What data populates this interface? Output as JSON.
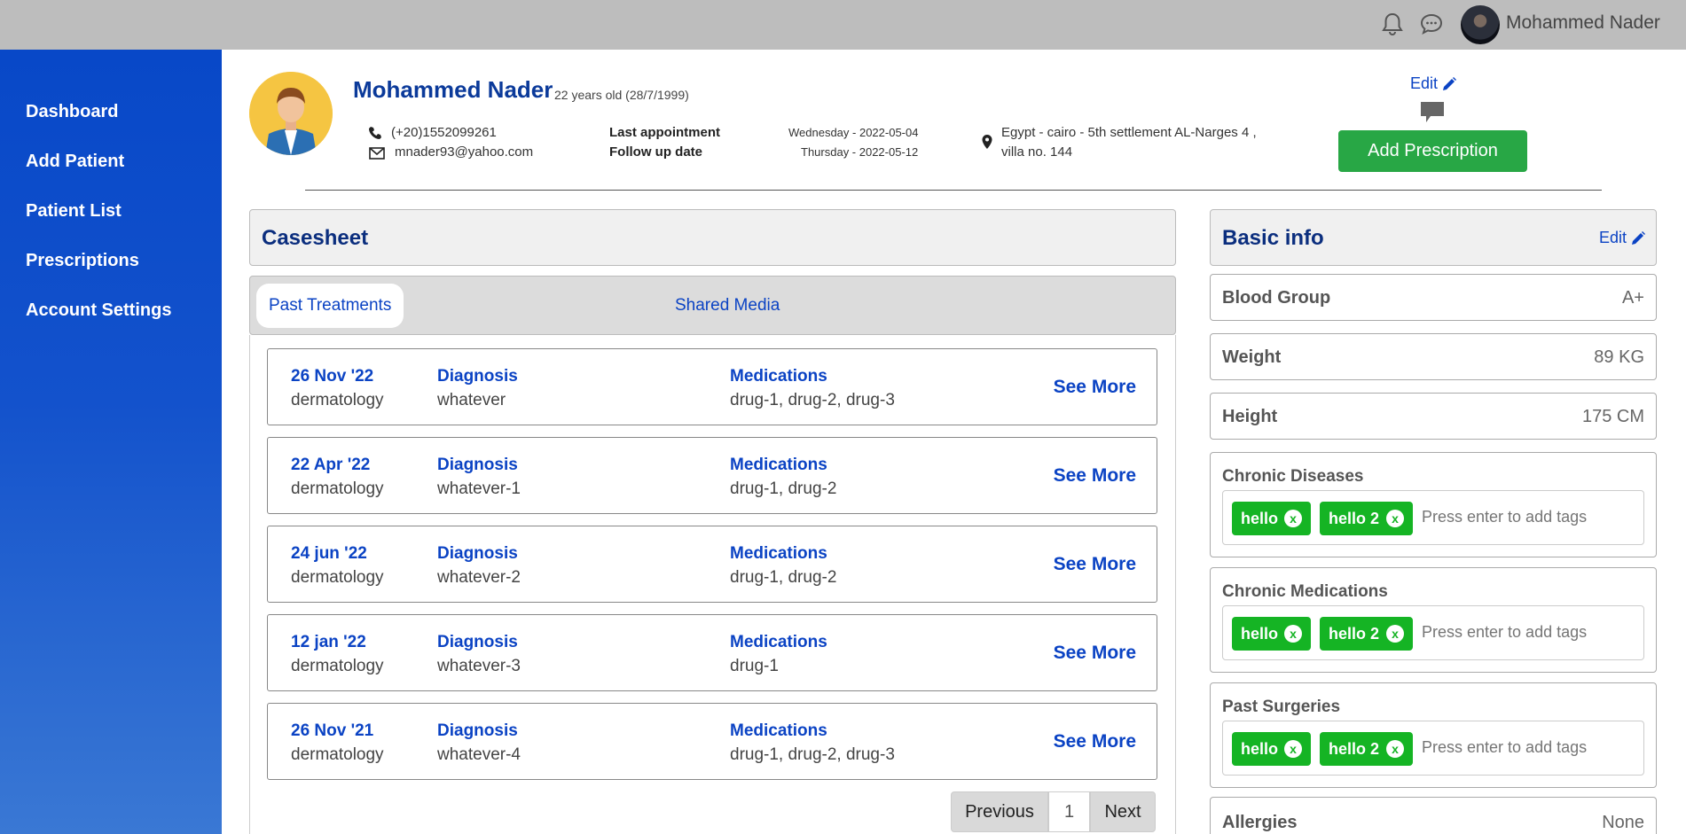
{
  "topbar": {
    "user_name": "Mohammed Nader",
    "icons": [
      "bell-icon",
      "chat-icon"
    ]
  },
  "sidebar": {
    "items": [
      {
        "label": "Dashboard"
      },
      {
        "label": "Add Patient"
      },
      {
        "label": "Patient List"
      },
      {
        "label": "Prescriptions"
      },
      {
        "label": "Account Settings"
      }
    ]
  },
  "patient": {
    "name": "Mohammed Nader",
    "age": "22 years old (28/7/1999)",
    "phone": "(+20)1552099261",
    "email": "mnader93@yahoo.com",
    "last_appointment_label": "Last appointment",
    "last_appointment": "Wednesday - 2022-05-04",
    "follow_up_label": "Follow up date",
    "follow_up": "Thursday - 2022-05-12",
    "address_line1": "Egypt - cairo - 5th settlement AL-Narges 4 ,",
    "address_line2": "villa no. 144"
  },
  "header_actions": {
    "edit_label": "Edit",
    "add_prescription_label": "Add Prescription"
  },
  "casesheet": {
    "title": "Casesheet",
    "tabs": [
      {
        "label": "Past Treatments"
      },
      {
        "label": "Shared Media"
      }
    ],
    "diagnosis_label": "Diagnosis",
    "medications_label": "Medications",
    "see_more_label": "See More",
    "treatments": [
      {
        "date": "26 Nov '22",
        "specialty": "dermatology",
        "diagnosis": "whatever",
        "medications": "drug-1, drug-2, drug-3"
      },
      {
        "date": "22 Apr '22",
        "specialty": "dermatology",
        "diagnosis": "whatever-1",
        "medications": "drug-1, drug-2"
      },
      {
        "date": "24 jun '22",
        "specialty": "dermatology",
        "diagnosis": "whatever-2",
        "medications": "drug-1, drug-2"
      },
      {
        "date": "12 jan '22",
        "specialty": "dermatology",
        "diagnosis": "whatever-3",
        "medications": "drug-1"
      },
      {
        "date": "26 Nov '21",
        "specialty": "dermatology",
        "diagnosis": "whatever-4",
        "medications": "drug-1, drug-2, drug-3"
      }
    ],
    "pagination": {
      "previous": "Previous",
      "page": "1",
      "next": "Next"
    }
  },
  "basic_info": {
    "title": "Basic info",
    "edit_label": "Edit",
    "blood_group_label": "Blood Group",
    "blood_group": "A+",
    "weight_label": "Weight",
    "weight": "89 KG",
    "height_label": "Height",
    "height": "175 CM",
    "tag_sections": [
      {
        "label": "Chronic Diseases",
        "tags": [
          "hello",
          "hello 2"
        ],
        "placeholder": "Press enter to add tags"
      },
      {
        "label": "Chronic Medications",
        "tags": [
          "hello",
          "hello 2"
        ],
        "placeholder": "Press enter to add tags"
      },
      {
        "label": "Past Surgeries",
        "tags": [
          "hello",
          "hello 2"
        ],
        "placeholder": "Press enter to add tags"
      }
    ],
    "tag_remove_label": "x",
    "allergies_label": "Allergies",
    "allergies": "None"
  },
  "colors": {
    "sidebar": "#0848c8",
    "accent": "#0b43c4",
    "title": "#0b2e7e",
    "green_button": "#28a745",
    "tag_green": "#15b424"
  }
}
